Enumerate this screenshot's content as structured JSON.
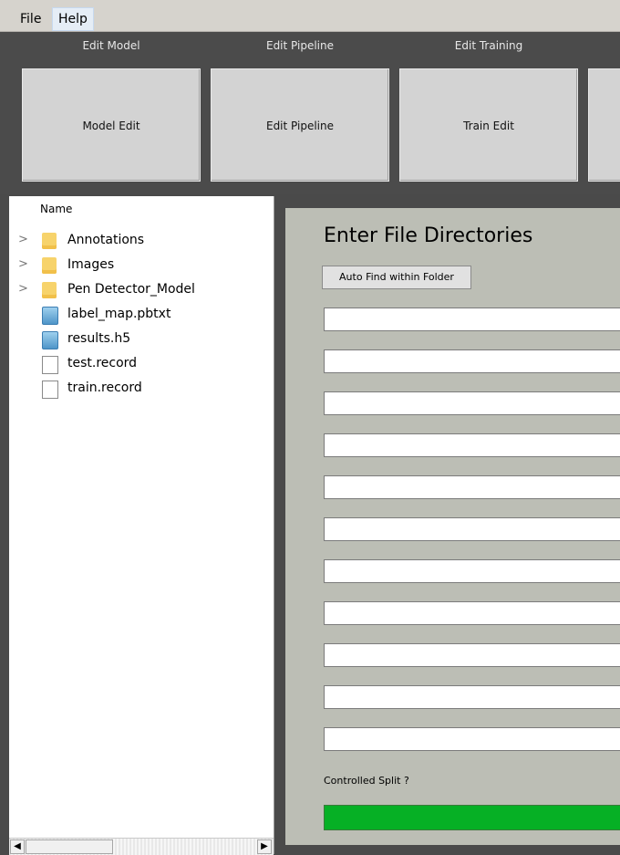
{
  "menu": {
    "items": [
      "File",
      "Help"
    ]
  },
  "tabs": [
    "Edit Model",
    "Edit Pipeline",
    "Edit Training"
  ],
  "buttons": [
    "Model Edit",
    "Edit Pipeline",
    "Train Edit"
  ],
  "file_tree": {
    "column_header": "Name",
    "items": [
      {
        "name": "Annotations",
        "type": "folder"
      },
      {
        "name": "Images",
        "type": "folder"
      },
      {
        "name": "Pen Detector_Model",
        "type": "folder"
      },
      {
        "name": "label_map.pbtxt",
        "type": "data-file"
      },
      {
        "name": "results.h5",
        "type": "data-file"
      },
      {
        "name": "test.record",
        "type": "file"
      },
      {
        "name": "train.record",
        "type": "file"
      }
    ]
  },
  "directories": {
    "title": "Enter File Directories",
    "auto_find_label": "Auto Find within Folder",
    "inputs": [
      "",
      "",
      "",
      "",
      "",
      "",
      "",
      "",
      "",
      "",
      ""
    ],
    "split_label": "Controlled Split ?"
  },
  "progress": {
    "value": 1.0,
    "color": "#06b025"
  }
}
